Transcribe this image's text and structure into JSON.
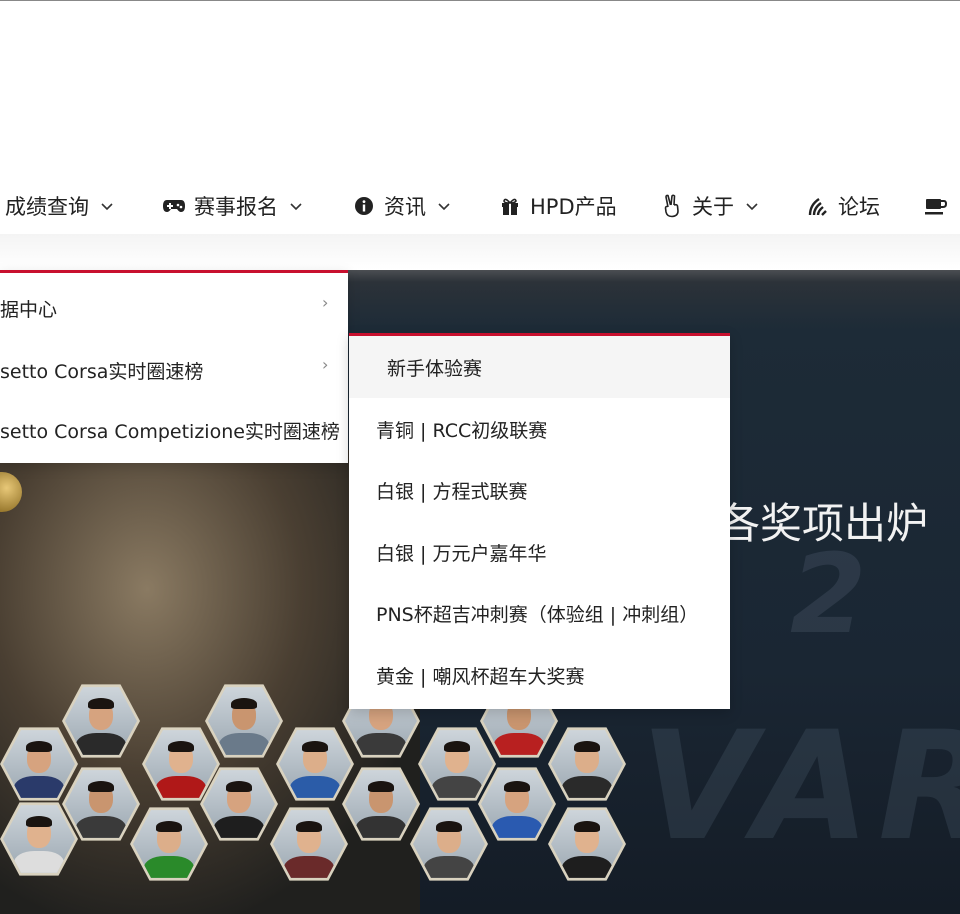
{
  "nav": {
    "items": [
      {
        "label": "成绩查询",
        "icon": "none",
        "has_dropdown": true
      },
      {
        "label": "赛事报名",
        "icon": "gamepad-icon",
        "has_dropdown": true
      },
      {
        "label": "资讯",
        "icon": "info-icon",
        "has_dropdown": true
      },
      {
        "label": "HPD产品",
        "icon": "gift-icon",
        "has_dropdown": false
      },
      {
        "label": "关于",
        "icon": "hand-peace-icon",
        "has_dropdown": true
      },
      {
        "label": "论坛",
        "icon": "wifi-icon",
        "has_dropdown": false
      },
      {
        "label": "",
        "icon": "coffee-icon",
        "has_dropdown": false
      }
    ]
  },
  "menu_level1": {
    "items": [
      {
        "label": "据中心"
      },
      {
        "label": "setto Corsa实时圈速榜"
      },
      {
        "label": "setto Corsa Competizione实时圈速榜"
      }
    ]
  },
  "menu_level2": {
    "items": [
      {
        "label": "新手体验赛",
        "active": true
      },
      {
        "label": "青铜 | RCC初级联赛"
      },
      {
        "label": "白银 | 方程式联赛"
      },
      {
        "label": "白银 | 万元户嘉年华"
      },
      {
        "label": "PNS杯超吉冲刺赛（体验组 | 冲刺组）"
      },
      {
        "label": "黄金 | 嘲风杯超车大奖赛"
      }
    ]
  },
  "hero": {
    "title_fragment": "各奖项出炉",
    "bg_text_1": "2",
    "bg_text_2": "VAR"
  },
  "colors": {
    "accent": "#c8102e",
    "nav_text": "#222222",
    "hero_bg": "#1a2633"
  }
}
